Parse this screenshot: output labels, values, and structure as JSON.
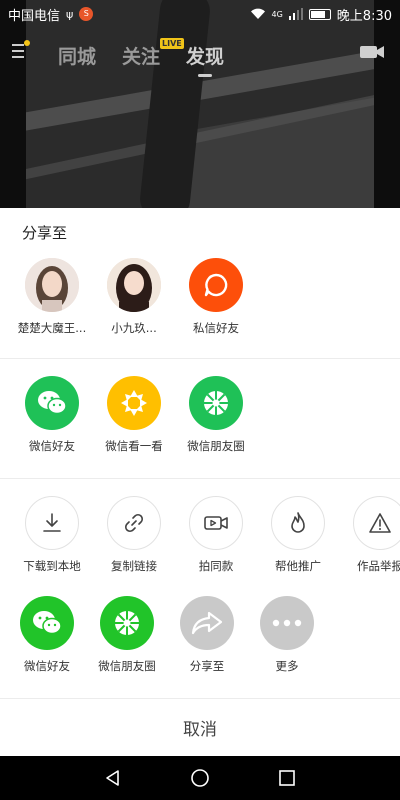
{
  "status": {
    "carrier": "中国电信",
    "usb": "ψ",
    "notif": "S",
    "network": "4G",
    "time": "晚上8:30"
  },
  "nav": {
    "tabs": [
      {
        "label": "同城"
      },
      {
        "label": "关注"
      },
      {
        "label": "发现"
      }
    ],
    "live_badge": "LIVE"
  },
  "share": {
    "title": "分享至",
    "contacts": [
      {
        "label": "楚楚大魔王..."
      },
      {
        "label": "小九玖..."
      },
      {
        "label": "私信好友",
        "icon": "chat-bubble-icon"
      }
    ],
    "wechat_row": [
      {
        "label": "微信好友",
        "icon": "wechat-icon"
      },
      {
        "label": "微信看一看",
        "icon": "wechat-look-icon"
      },
      {
        "label": "微信朋友圈",
        "icon": "moments-icon"
      }
    ],
    "actions": [
      {
        "label": "下载到本地",
        "icon": "download-icon"
      },
      {
        "label": "复制链接",
        "icon": "link-icon"
      },
      {
        "label": "拍同款",
        "icon": "video-camera-icon"
      },
      {
        "label": "帮他推广",
        "icon": "flame-icon"
      },
      {
        "label": "作品举报",
        "icon": "warning-icon"
      }
    ],
    "system_row": [
      {
        "label": "微信好友",
        "icon": "wechat-icon"
      },
      {
        "label": "微信朋友圈",
        "icon": "moments-icon"
      },
      {
        "label": "分享至",
        "icon": "share-arrow-icon"
      },
      {
        "label": "更多",
        "icon": "more-dots-icon"
      }
    ],
    "cancel": "取消"
  },
  "colors": {
    "wechat_green": "#1fc157",
    "look_yellow": "#ffbf00",
    "message_orange": "#fd4f0a",
    "system_gray": "#c9c9c9"
  }
}
